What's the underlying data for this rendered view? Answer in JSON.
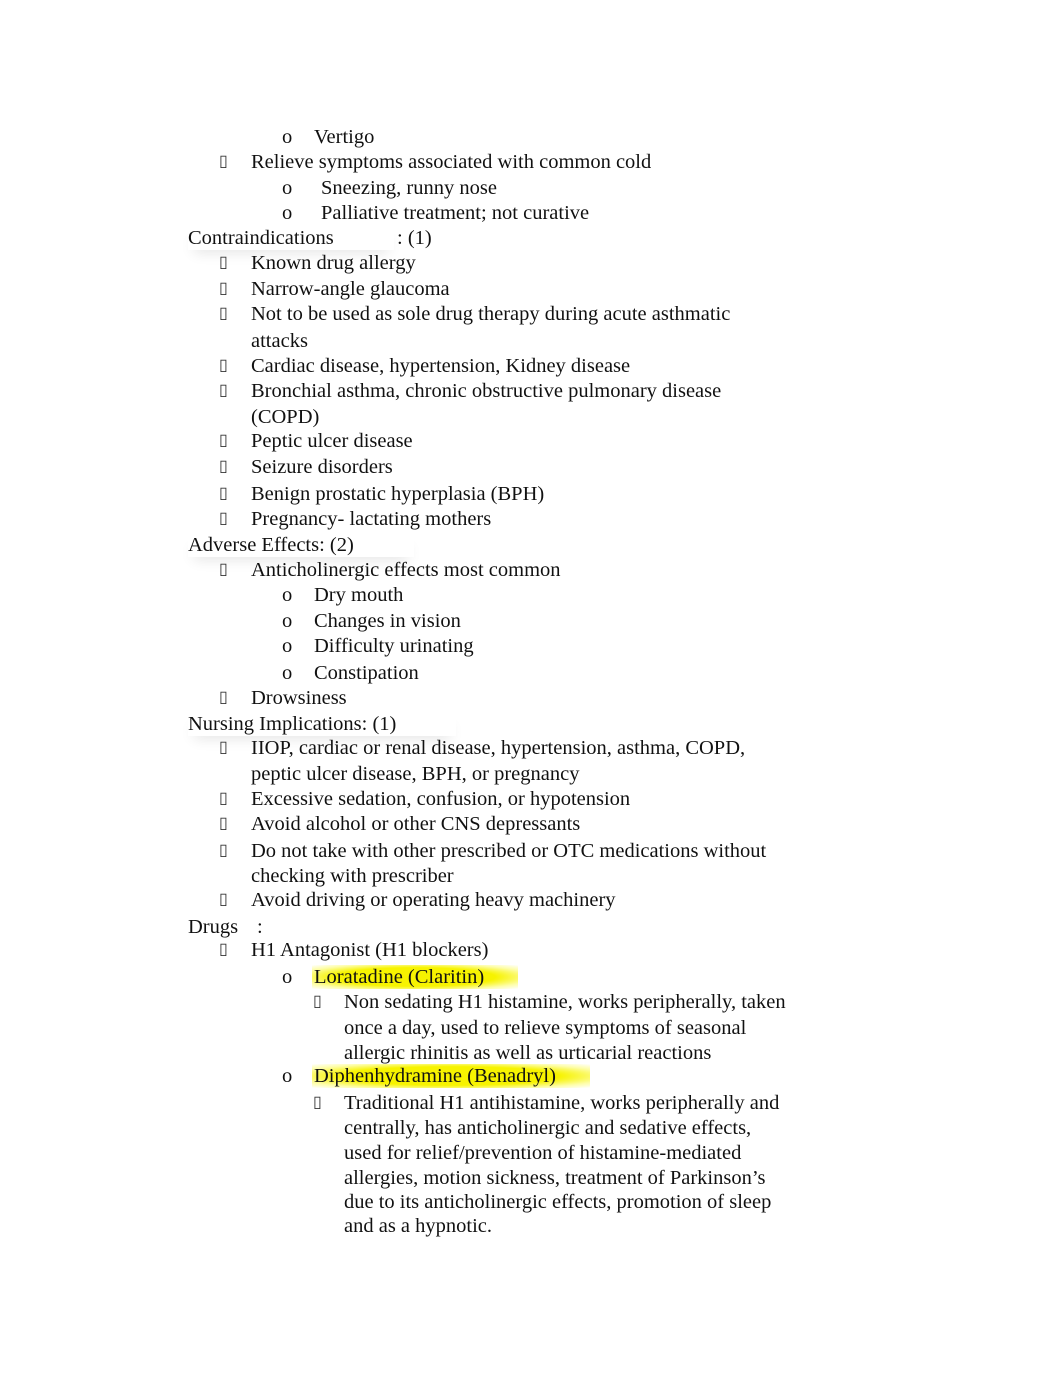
{
  "document": {
    "intro": {
      "sub_items": [
        "Vertigo"
      ],
      "cold_item": "Relieve symptoms associated with common cold",
      "cold_sub_items": [
        "Sneezing, runny nose",
        "Palliative treatment; not curative"
      ]
    },
    "contraindications": {
      "heading": "Contraindications",
      "heading_suffix": ": (1)",
      "items": [
        "Known drug allergy",
        "Narrow-angle glaucoma",
        "Not to be used as sole drug therapy during acute asthmatic",
        "attacks",
        "Cardiac disease, hypertension, Kidney disease",
        "Bronchial asthma, chronic obstructive pulmonary disease",
        "(COPD)",
        "Peptic ulcer disease",
        "Seizure disorders",
        "Benign prostatic hyperplasia (BPH)",
        "Pregnancy- lactating mothers"
      ]
    },
    "adverse_effects": {
      "heading": "Adverse Effects: (2)",
      "item1": "Anticholinergic effects most common",
      "sub_items": [
        "Dry mouth",
        "Changes in vision",
        "Difficulty urinating",
        "Constipation"
      ],
      "item2": "Drowsiness"
    },
    "nursing": {
      "heading": "Nursing Implications: (1)",
      "items": [
        "IIOP, cardiac or renal disease, hypertension, asthma, COPD,",
        "peptic ulcer disease, BPH, or pregnancy",
        "Excessive sedation, confusion, or hypotension",
        "Avoid alcohol or other CNS depressants",
        "Do not take with other prescribed or OTC medications without",
        "checking with prescriber",
        "Avoid driving or operating heavy machinery"
      ]
    },
    "drugs": {
      "heading": "Drugs",
      "heading_suffix": ":",
      "class_item": "H1 Antagonist (H1 blockers)",
      "drug1": {
        "name": "Loratadine (Claritin)",
        "desc": [
          "Non sedating H1 histamine, works peripherally, taken",
          "once a day, used to relieve symptoms of seasonal",
          "allergic rhinitis as well as urticarial reactions"
        ]
      },
      "drug2": {
        "name": "Diphenhydramine (Benadryl)",
        "desc": [
          "Traditional H1 antihistamine, works peripherally and",
          "centrally, has anticholinergic and sedative effects,",
          "used for relief/prevention of histamine-mediated",
          "allergies, motion sickness, treatment of Parkinson’s",
          "due to its anticholinergic effects, promotion of sleep",
          "and as a hypnotic."
        ]
      }
    },
    "bullets": {
      "level1": "▯",
      "level2": "o",
      "level3": "▯"
    },
    "highlight_color": "#f7f300"
  }
}
